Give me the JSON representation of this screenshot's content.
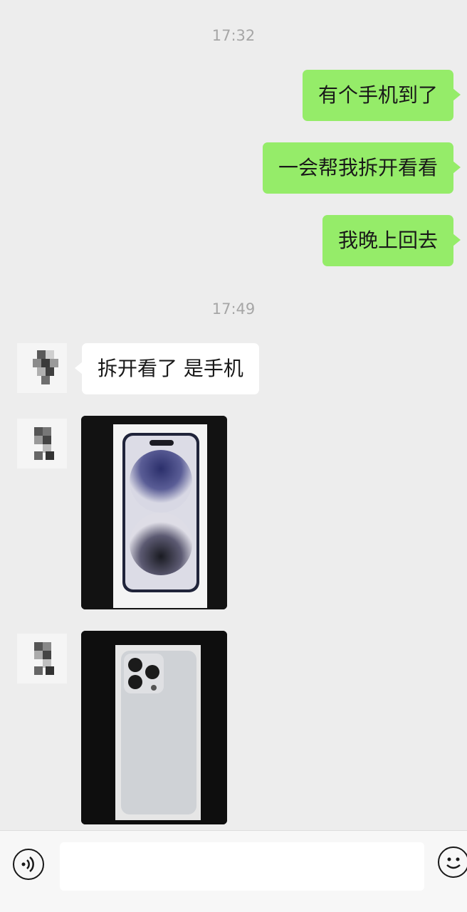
{
  "chat": {
    "timestamp_1": "17:32",
    "timestamp_2": "17:49",
    "messages_out": [
      "有个手机到了",
      "一会帮我拆开看看",
      "我晚上回去"
    ],
    "message_in": "拆开看了 是手机"
  },
  "photos": [
    {
      "icon": "phone-box-front-image"
    },
    {
      "icon": "phone-back-image"
    }
  ],
  "input_bar": {
    "voice_icon": "voice-icon",
    "text_value": "",
    "emoji_icon": "emoji-icon"
  },
  "colors": {
    "background": "#ededed",
    "outgoing_bubble": "#95ec69",
    "incoming_bubble": "#ffffff",
    "timestamp_text": "#a6a6a6"
  }
}
